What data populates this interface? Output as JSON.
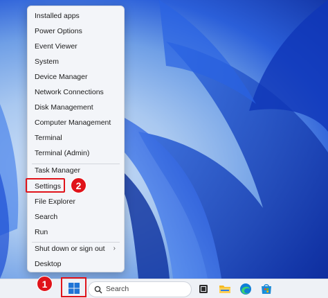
{
  "menu": {
    "items": [
      {
        "label": "Installed apps"
      },
      {
        "label": "Power Options"
      },
      {
        "label": "Event Viewer"
      },
      {
        "label": "System"
      },
      {
        "label": "Device Manager"
      },
      {
        "label": "Network Connections"
      },
      {
        "label": "Disk Management"
      },
      {
        "label": "Computer Management"
      },
      {
        "label": "Terminal"
      },
      {
        "label": "Terminal (Admin)"
      },
      {
        "label": "Task Manager"
      },
      {
        "label": "Settings"
      },
      {
        "label": "File Explorer"
      },
      {
        "label": "Search"
      },
      {
        "label": "Run"
      },
      {
        "label": "Shut down or sign out"
      },
      {
        "label": "Desktop"
      }
    ],
    "submenu_chevron": "›"
  },
  "annotations": {
    "step1": "1",
    "step2": "2",
    "highlight_color": "#e0131a"
  },
  "taskbar": {
    "search_placeholder": "Search",
    "icons": [
      "windows-start-icon",
      "search-icon",
      "task-view-icon",
      "file-explorer-icon",
      "edge-icon",
      "store-icon"
    ]
  }
}
